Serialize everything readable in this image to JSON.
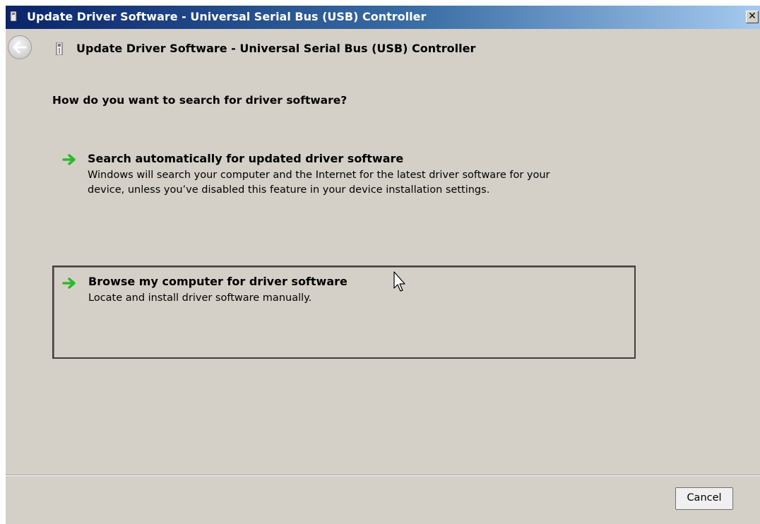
{
  "window": {
    "title": "Update Driver Software - Universal Serial Bus (USB) Controller",
    "close_label": "✕"
  },
  "header": {
    "title": "Update Driver Software - Universal Serial Bus (USB) Controller"
  },
  "main": {
    "question": "How do you want to search for driver software?",
    "options": [
      {
        "title": "Search automatically for updated driver software",
        "description_lines": [
          "Windows will search your computer and the Internet for the latest driver software for your",
          "device, unless you’ve disabled this feature in your device installation settings."
        ]
      },
      {
        "title": "Browse my computer for driver software",
        "description_lines": [
          "Locate and install driver software manually."
        ]
      }
    ]
  },
  "footer": {
    "cancel_label": "Cancel"
  },
  "colors": {
    "titlebar_start": "#0a246a",
    "titlebar_end": "#a6caf0",
    "window_bg": "#d4d0c8",
    "arrow_green": "#2eb82e"
  },
  "icons": {
    "title": "usb-device-icon",
    "back": "back-arrow-icon",
    "header": "usb-device-icon",
    "option_arrow": "green-arrow-icon",
    "pointer": "mouse-pointer-icon"
  }
}
